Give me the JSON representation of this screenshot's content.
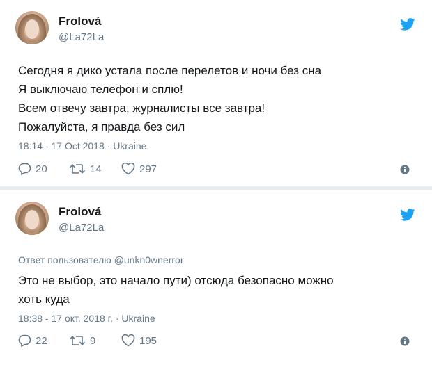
{
  "tweets": [
    {
      "author_name": "Frolová",
      "handle": "@La72La",
      "reply_prefix": "",
      "reply_mention": "",
      "text": "Сегодня я дико устала после перелетов и ночи без сна\nЯ выключаю телефон и сплю!\nВсем отвечу завтра, журналисты все завтра!\nПожалуйста, я правда без сил",
      "timestamp": "18:14 - 17 Oct 2018 · Ukraine",
      "replies": "20",
      "retweets": "14",
      "likes": "297"
    },
    {
      "author_name": "Frolová",
      "handle": "@La72La",
      "reply_prefix": "Ответ пользователю",
      "reply_mention": "@unkn0wnerror",
      "text": "Это не выбор, это начало пути) отсюда безопасно можно\nхоть куда",
      "timestamp": "18:38 - 17 окт. 2018 г. · Ukraine",
      "replies": "22",
      "retweets": "9",
      "likes": "195"
    }
  ],
  "colors": {
    "twitter_blue": "#1da1f2",
    "text": "#14171a",
    "secondary_text": "#657786",
    "background": "#e6ecf0"
  },
  "icons": [
    "twitter-bird-icon",
    "reply-icon",
    "retweet-icon",
    "like-icon",
    "info-icon"
  ]
}
